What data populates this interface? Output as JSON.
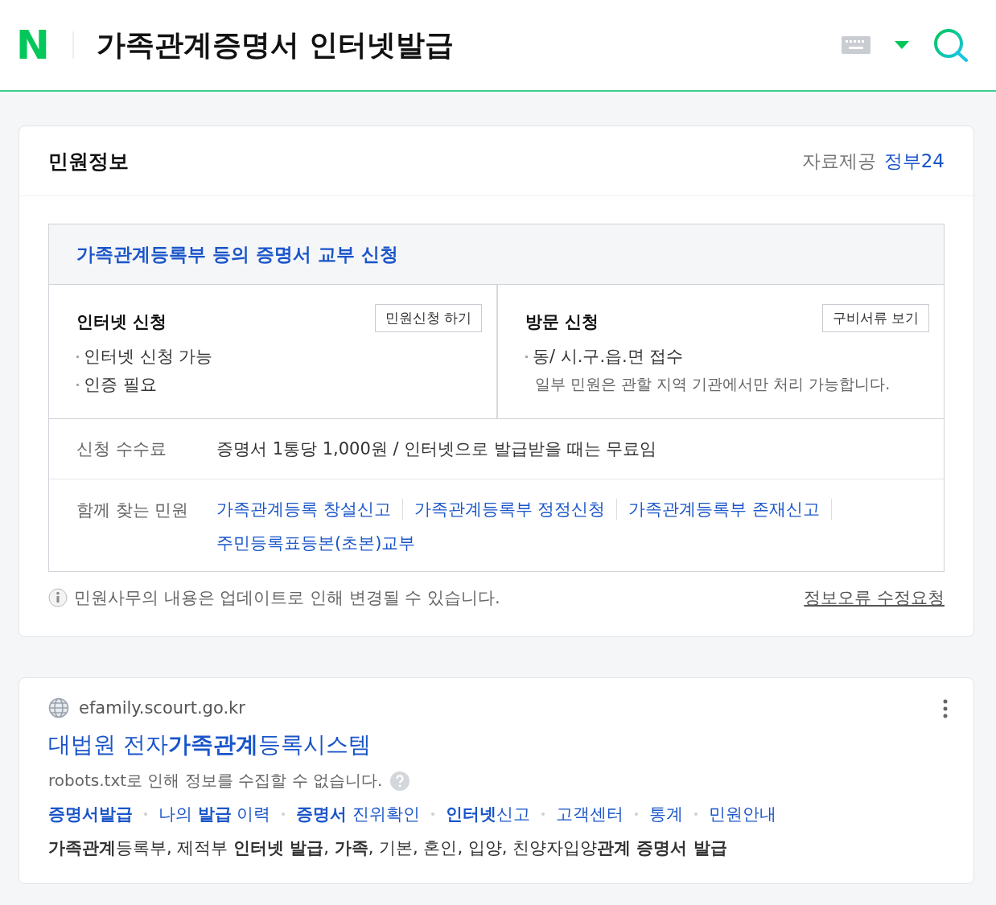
{
  "header": {
    "logo": "N",
    "query": "가족관계증명서 인터넷발급"
  },
  "civil_info": {
    "title": "민원정보",
    "source_label": "자료제공",
    "source_link": "정부24",
    "service_title": "가족관계등록부 등의 증명서 교부 신청",
    "methods": [
      {
        "title": "인터넷 신청",
        "button": "민원신청 하기",
        "bullets": [
          "인터넷 신청 가능",
          "인증 필요"
        ]
      },
      {
        "title": "방문 신청",
        "button": "구비서류 보기",
        "bullets": [
          "동/ 시.구.읍.면 접수"
        ],
        "note": "일부 민원은 관할 지역 기관에서만 처리 가능합니다."
      }
    ],
    "fee_label": "신청 수수료",
    "fee": "증명서 1통당 1,000원 / 인터넷으로 발급받을 때는 무료임",
    "related_label": "함께 찾는 민원",
    "related": [
      "가족관계등록 창설신고",
      "가족관계등록부 정정신청",
      "가족관계등록부 존재신고",
      "주민등록표등본(초본)교부"
    ],
    "notice": "민원사무의 내용은 업데이트로 인해 변경될 수 있습니다.",
    "report_link": "정보오류 수정요청"
  },
  "result": {
    "url": "efamily.scourt.go.kr",
    "title": "대법원 전자**가족관계**등록시스템",
    "snippet": "robots.txt로 인해 정보를 수집할 수 없습니다.",
    "sitelinks": [
      "**증명서발급**",
      "나의 **발급** 이력",
      "**증명서** 진위확인",
      "**인터넷**신고",
      "고객센터",
      "통계",
      "민원안내"
    ],
    "keywords": "**가족관계**등록부, 제적부 **인터넷 발급**, **가족**, 기본, 혼인, 입양, 친양자입양**관계 증명서 발급**"
  }
}
